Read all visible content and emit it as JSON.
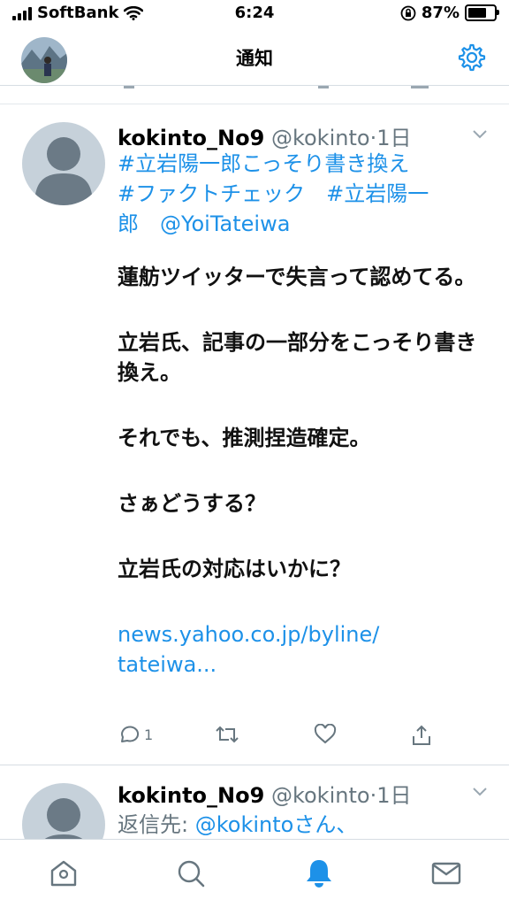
{
  "status_bar": {
    "carrier": "SoftBank",
    "time": "6:24",
    "battery": "87%",
    "battery_level": 0.87
  },
  "nav": {
    "title": "通知",
    "avatar_icon": "profile-photo",
    "settings_icon": "gear-icon"
  },
  "tweets": [
    {
      "name": "kokinto_No9",
      "handle": "@kokinto",
      "dot": "·",
      "time": "1日",
      "hashtag_line1": "#立岩陽一郎こっそり書き換え",
      "hashtag_line2": "#ファクトチェック　#立岩陽一",
      "hashtag_line3a": "郎",
      "mention": "@YoiTateiwa",
      "para1_line1": "蓮舫ツイッターで失言って認めてる。",
      "para2_line1": "立岩氏、記事の一部分をこっそり書き換え。",
      "para3": "それでも、推測捏造確定。",
      "para4": "さぁどうする？",
      "para5": "立岩氏の対応はいかに？",
      "link_line1": "news.yahoo.co.jp/byline/",
      "link_line2": "tateiwa...",
      "reply_count": "1"
    },
    {
      "name": "kokinto_No9",
      "handle": "@kokinto",
      "dot": "·",
      "time": "1日",
      "reply_to_prefix": "返信先: ",
      "reply_to_user": "@kokintoさん、"
    }
  ],
  "colors": {
    "link": "#1d91e8",
    "meta": "#67767f",
    "active_tab": "#1d91e8",
    "divider": "#d6dde3"
  },
  "tabs": [
    "home-icon",
    "search-icon",
    "notifications-bell-icon",
    "messages-envelope-icon"
  ]
}
